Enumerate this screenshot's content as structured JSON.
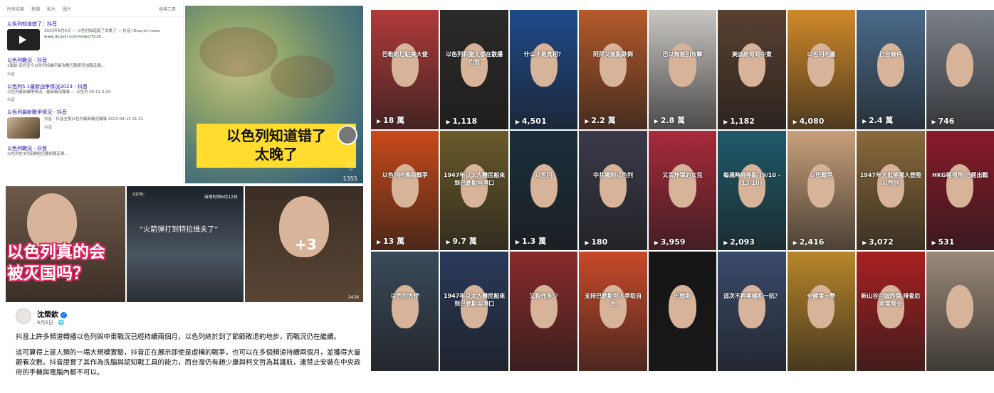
{
  "search": {
    "tabs": [
      "所有結果",
      "新聞",
      "影片",
      "圖片"
    ],
    "tools": "搜尋工具",
    "results": [
      {
        "title": "以色列知道錯了：抖音",
        "text": "2023年6月5日 — 以色列知道錯了太晚了 — 抖音 (Douyin) news",
        "url": "www.douyin.com/video/7219...",
        "tag": "抖音",
        "thumb": "play"
      },
      {
        "title": "以色列戰況 - 抖音",
        "text": "1周前 四月至今以色列持續不斷攻擊巴勒斯坦加薩走廊…",
        "url": "",
        "tag": "抖音",
        "thumb": ""
      },
      {
        "title": "以色列5.1最新战争情况2023 - 抖音",
        "text": "以色列最新戰爭情況 - 最新戰況報導 — 以色列 00:11 0:43",
        "url": "",
        "tag": "抖音",
        "thumb": ""
      },
      {
        "title": "以色列最新戰爭情況 - 抖音",
        "text": "抖音 - 抖音全景以色列最新戰況報導 2023-04-15 21:31",
        "url": "",
        "tag": "抖音",
        "thumb": "img"
      },
      {
        "title": "以色列戰況 - 抖音",
        "text": "以色列在4月底開始空襲加薩走廊…",
        "url": "",
        "tag": "抖音",
        "thumb": ""
      }
    ]
  },
  "big_video": {
    "caption_line1": "以色列知道错了",
    "caption_line2": "太晚了",
    "count": "1355"
  },
  "fb_images": {
    "img1_overlay_line1": "以色列真的会",
    "img1_overlay_line2": "被灭国吗？",
    "img2_caption": "“火箭弹打到特拉维夫了”",
    "img2_date": "当地时间6月12日",
    "img2_logo": "CGTN",
    "img3_more": "+3",
    "img3_count": "2428"
  },
  "post": {
    "author": "沈榮欽",
    "date": "6月6日 · ",
    "paragraphs": [
      "抖音上許多頻道轉播以色列與中東戰況已經持續兩個月，以色列終於到了節節敗退的地步，而戰況仍在繼續。",
      "這可算得上是人類的一場大規模實驗，抖音正在展示即使是虛構的戰爭，也可以在多個頻道持續兩個月，並獲得大量觀看次數。抖音證實了其作為洗腦與認知戰工具的能力，而台灣仍有趙少康與柯文哲為其護航，連禁止安裝在中央政府的手機與電腦內都不可以。"
    ]
  },
  "tiktok": {
    "tiles": [
      {
        "count": "18 萬",
        "label": "巴勒斯坦駐美大使",
        "bg": "#b03a3a"
      },
      {
        "count": "1,118",
        "label": "以色列和猶太都在散播仇恨",
        "bg": "#2c2a28"
      },
      {
        "count": "4,501",
        "label": "什么才是真相？",
        "bg": "#1e4a8a"
      },
      {
        "count": "2.2 萬",
        "label": "阿拜又差點跌倒",
        "bg": "#b45a2a"
      },
      {
        "count": "2.8 萬",
        "label": "巴以無差別攻擊",
        "bg": "#c9c6c2"
      },
      {
        "count": "1,182",
        "label": "美派航母到中東",
        "bg": "#5a4030"
      },
      {
        "count": "4,080",
        "label": "以色列地圖",
        "bg": "#d18a2a"
      },
      {
        "count": "2.4 萬",
        "label": "打台條件",
        "bg": "#4a6a8a"
      },
      {
        "count": "746",
        "label": "",
        "bg": "#7a8088"
      },
      {
        "count": "13 萬",
        "label": "以色列哈瑪斯戰爭",
        "bg": "#c84a1a"
      },
      {
        "count": "9.7 萬",
        "label": "1947年以太人難民船來到巴勒斯坦港口",
        "bg": "#6a5a2a"
      },
      {
        "count": "1.3 萬",
        "label": "以色列",
        "bg": "#1a2e3a"
      },
      {
        "count": "180",
        "label": "中共國制以色列",
        "bg": "#3a3a4a"
      },
      {
        "count": "3,959",
        "label": "又丟炸彈的女兒",
        "bg": "#a82a3a"
      },
      {
        "count": "2,093",
        "label": "每週時經熱點 (9/10 - 13/10)",
        "bg": "#1f5a6a"
      },
      {
        "count": "2,416",
        "label": "以巴戰爭",
        "bg": "#c8a07a"
      },
      {
        "count": "3,072",
        "label": "1947年大批美國人登陸以色列",
        "bg": "#8a6a3a"
      },
      {
        "count": "531",
        "label": "HKG報視角 已經出戰",
        "bg": "#8a1a2a"
      },
      {
        "count": "",
        "label": "以色列大使",
        "bg": "#3a4a5a"
      },
      {
        "count": "",
        "label": "1947年以太人難民船來到巴勒斯坦港口",
        "bg": "#2a3a5a"
      },
      {
        "count": "",
        "label": "又殺死多少",
        "bg": "#8a2a2a"
      },
      {
        "count": "",
        "label": "支持巴勒斯坦人爭取自由",
        "bg": "#c84a2a"
      },
      {
        "count": "",
        "label": "巴勒斯",
        "bg": "#151515"
      },
      {
        "count": "",
        "label": "這次不再美國和一抗？",
        "bg": "#3a4a6a"
      },
      {
        "count": "",
        "label": "全國第一勢",
        "bg": "#b8862a"
      },
      {
        "count": "",
        "label": "新山谷中城炸彈 排查后照常营业",
        "bg": "#a82020"
      },
      {
        "count": "",
        "label": "",
        "bg": "#9a8a7a"
      }
    ]
  }
}
